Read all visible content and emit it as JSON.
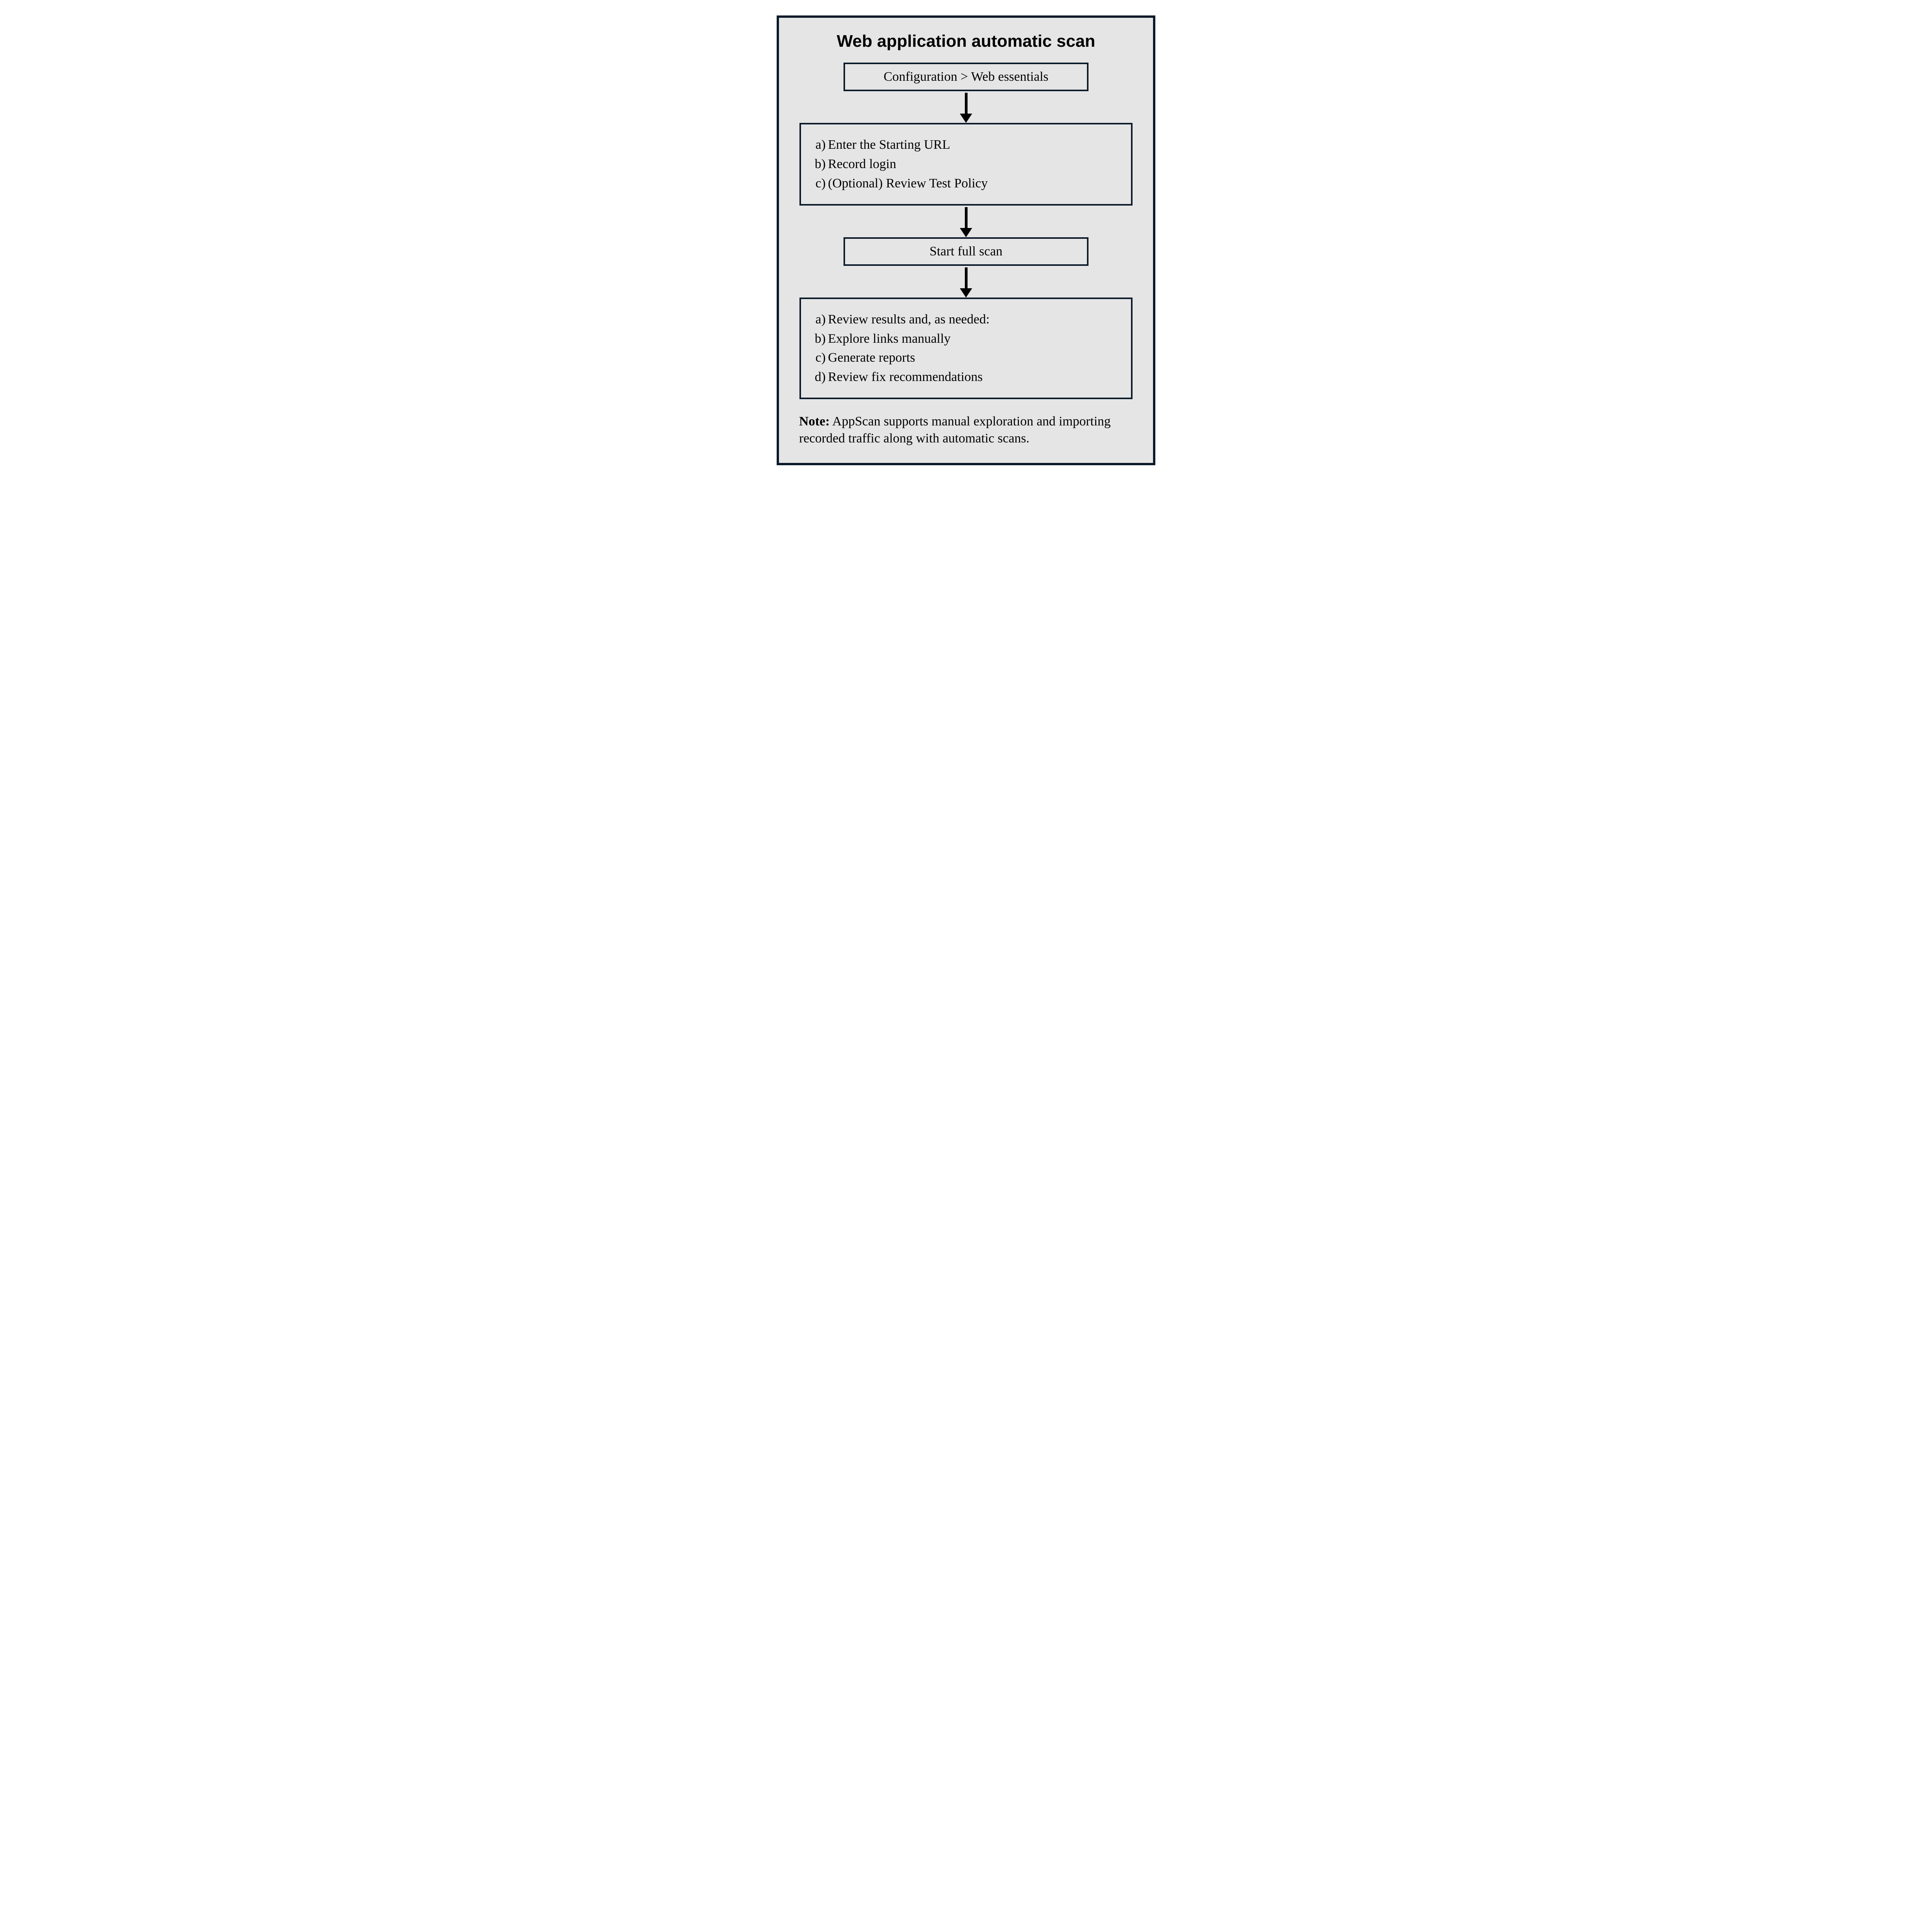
{
  "title": "Web application automatic scan",
  "steps": {
    "s1": "Configuration > Web essentials",
    "s2": {
      "a": "Enter the Starting URL",
      "b": "Record login",
      "c": "(Optional) Review Test Policy"
    },
    "s3": "Start full scan",
    "s4": {
      "a": "Review results and, as needed:",
      "b": "Explore links manually",
      "c": "Generate reports",
      "d": "Review fix recommendations"
    }
  },
  "note": {
    "label": "Note:",
    "text": " AppScan supports manual exploration and importing recorded traffic along with automatic scans."
  },
  "colors": {
    "border": "#0b1a2a",
    "bg": "#e5e5e5"
  }
}
